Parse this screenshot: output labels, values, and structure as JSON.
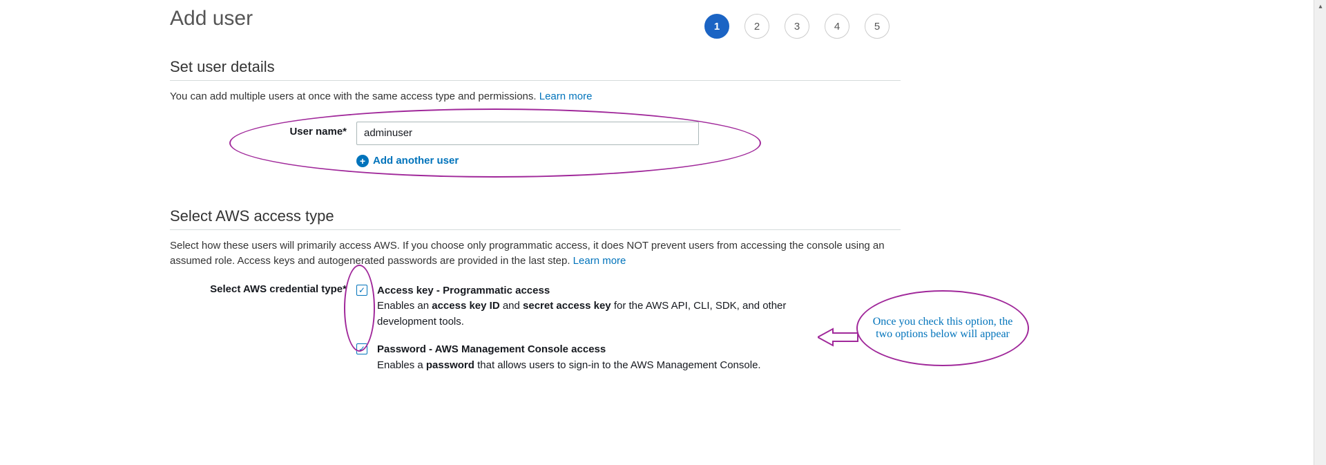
{
  "page": {
    "title": "Add user"
  },
  "stepper": {
    "steps": [
      "1",
      "2",
      "3",
      "4",
      "5"
    ],
    "active": 0
  },
  "section_details": {
    "title": "Set user details",
    "desc": "You can add multiple users at once with the same access type and permissions. ",
    "learn_more": "Learn more",
    "username_label": "User name*",
    "username_value": "adminuser",
    "add_another": "Add another user"
  },
  "section_access": {
    "title": "Select AWS access type",
    "desc": "Select how these users will primarily access AWS. If you choose only programmatic access, it does NOT prevent users from accessing the console using an assumed role. Access keys and autogenerated passwords are provided in the last step. ",
    "learn_more": "Learn more",
    "cred_label": "Select AWS credential type*",
    "option1": {
      "title": "Access key - Programmatic access",
      "desc_pre": "Enables an ",
      "desc_b1": "access key ID",
      "desc_mid": " and ",
      "desc_b2": "secret access key",
      "desc_post": " for the AWS API, CLI, SDK, and other development tools."
    },
    "option2": {
      "title": "Password - AWS Management Console access",
      "desc_pre": "Enables a ",
      "desc_b1": "password",
      "desc_post": " that allows users to sign-in to the AWS Management Console."
    }
  },
  "annotation": {
    "callout": "Once you check this option, the two options below will appear"
  }
}
